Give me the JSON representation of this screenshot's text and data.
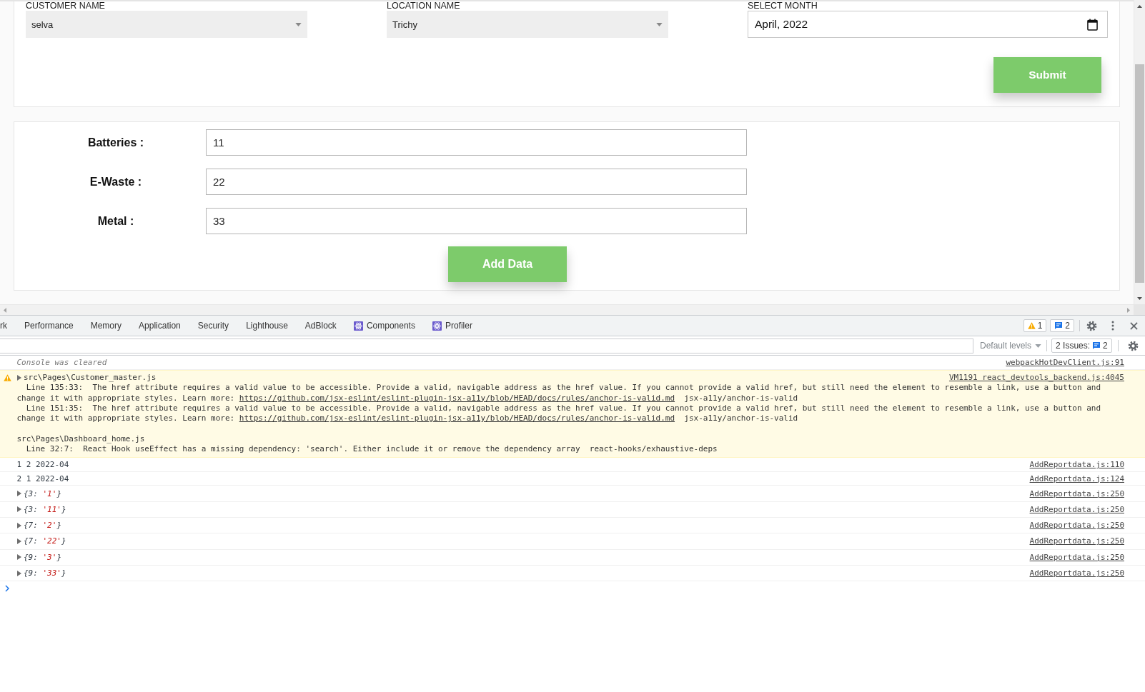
{
  "page": {
    "filters": [
      {
        "kind": "select",
        "label": "CUSTOMER NAME",
        "value": "selva"
      },
      {
        "kind": "select",
        "label": "LOCATION NAME",
        "value": "Trichy"
      },
      {
        "kind": "month",
        "label": "SELECT MONTH",
        "value": "April, 2022"
      }
    ],
    "submit_button": "Submit",
    "fields": [
      {
        "label": "Batteries :",
        "value": "11"
      },
      {
        "label": "E-Waste :",
        "value": "22"
      },
      {
        "label": "Metal :",
        "value": "33"
      }
    ],
    "add_button": "Add Data"
  },
  "devtools": {
    "tabs": [
      {
        "label": "rk",
        "kind": "plain",
        "selected": false
      },
      {
        "label": "Performance",
        "kind": "plain",
        "selected": false
      },
      {
        "label": "Memory",
        "kind": "plain",
        "selected": false
      },
      {
        "label": "Application",
        "kind": "plain",
        "selected": false
      },
      {
        "label": "Security",
        "kind": "plain",
        "selected": false
      },
      {
        "label": "Lighthouse",
        "kind": "plain",
        "selected": false
      },
      {
        "label": "AdBlock",
        "kind": "plain",
        "selected": false
      },
      {
        "label": "Components",
        "kind": "react",
        "selected": false
      },
      {
        "label": "Profiler",
        "kind": "react",
        "selected": false
      }
    ],
    "warnings_badge": "1",
    "messages_badge": "2",
    "filter_bar": {
      "levels": "Default levels",
      "issues_label": "2 Issues:",
      "issues_count": "2"
    },
    "console": [
      {
        "kind": "info",
        "text": "Console was cleared",
        "source": "webpackHotDevClient.js:91"
      },
      {
        "kind": "warning",
        "expanded": false,
        "source": "VM1191 react_devtools_backend.js:4045",
        "files": [
          {
            "path": "src\\Pages\\Customer_master.js",
            "messages": [
              {
                "text": "Line 135:33:  The href attribute requires a valid value to be accessible. Provide a valid, navigable address as the href value. If you cannot provide a valid href, but still need the element to resemble a link, use a button and change it with appropriate styles. Learn more: ",
                "link": "https://github.com/jsx-eslint/eslint-plugin-jsx-a11y/blob/HEAD/docs/rules/anchor-is-valid.md",
                "rule": "  jsx-a11y/anchor-is-valid"
              },
              {
                "text": "Line 151:35:  The href attribute requires a valid value to be accessible. Provide a valid, navigable address as the href value. If you cannot provide a valid href, but still need the element to resemble a link, use a button and change it with appropriate styles. Learn more: ",
                "link": "https://github.com/jsx-eslint/eslint-plugin-jsx-a11y/blob/HEAD/docs/rules/anchor-is-valid.md",
                "rule": "  jsx-a11y/anchor-is-valid"
              }
            ]
          },
          {
            "path": "src\\Pages\\Dashboard_home.js",
            "messages": [
              {
                "text": "Line 32:7:  React Hook useEffect has a missing dependency: 'search'. Either include it or remove the dependency array  react-hooks/exhaustive-deps"
              }
            ]
          }
        ]
      },
      {
        "kind": "log",
        "text": "1 2 2022-04",
        "source": "AddReportdata.js:110"
      },
      {
        "kind": "log",
        "text": "2 1 2022-04",
        "source": "AddReportdata.js:124"
      },
      {
        "kind": "object",
        "expanded": false,
        "open": "{3: ",
        "value": "'1'",
        "close": "}",
        "source": "AddReportdata.js:250"
      },
      {
        "kind": "object",
        "expanded": false,
        "open": "{3: ",
        "value": "'11'",
        "close": "}",
        "source": "AddReportdata.js:250"
      },
      {
        "kind": "object",
        "expanded": false,
        "open": "{7: ",
        "value": "'2'",
        "close": "}",
        "source": "AddReportdata.js:250"
      },
      {
        "kind": "object",
        "expanded": false,
        "open": "{7: ",
        "value": "'22'",
        "close": "}",
        "source": "AddReportdata.js:250"
      },
      {
        "kind": "object",
        "expanded": false,
        "open": "{9: ",
        "value": "'3'",
        "close": "}",
        "source": "AddReportdata.js:250"
      },
      {
        "kind": "object",
        "expanded": false,
        "open": "{9: ",
        "value": "'33'",
        "close": "}",
        "source": "AddReportdata.js:250"
      }
    ]
  }
}
